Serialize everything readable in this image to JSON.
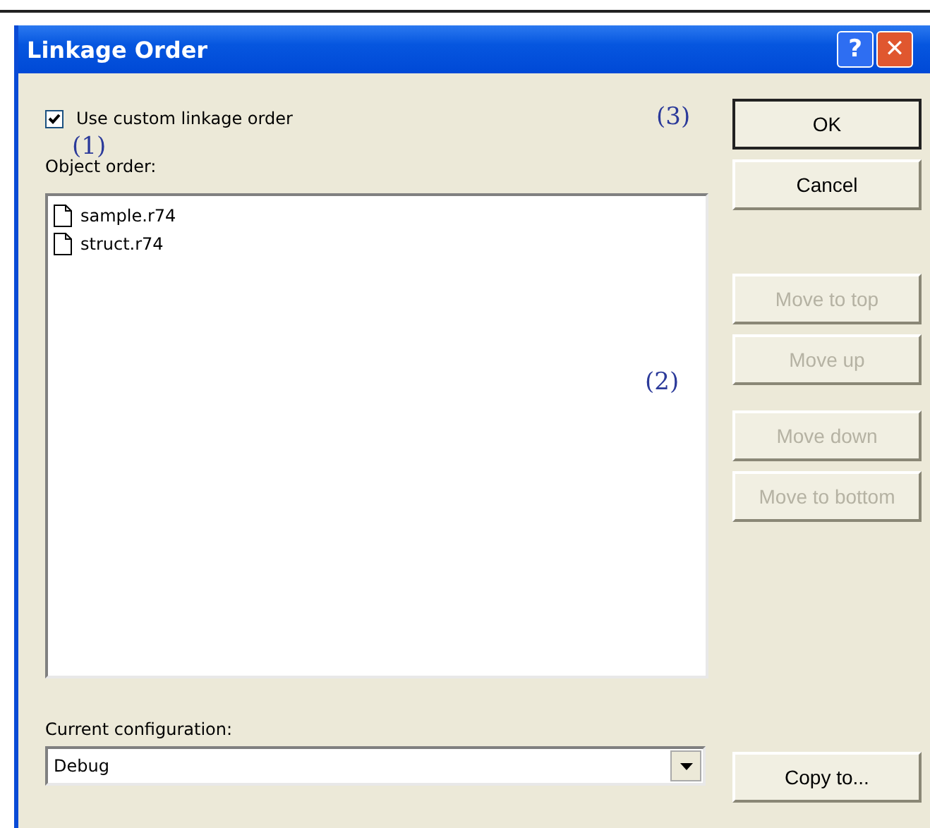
{
  "window": {
    "title": "Linkage Order",
    "title_buttons": [
      {
        "kind": "help",
        "label": "?"
      },
      {
        "kind": "close",
        "label": "✕"
      }
    ]
  },
  "custom_order": {
    "label": "Use custom linkage order",
    "checked": true
  },
  "object_order": {
    "label": "Object order:",
    "items": [
      {
        "label": "sample.r74"
      },
      {
        "label": "struct.r74"
      }
    ]
  },
  "configuration": {
    "label": "Current configuration:",
    "value": "Debug"
  },
  "button_groups": [
    {
      "buttons": [
        {
          "label": "OK",
          "default": true,
          "disabled": false
        },
        {
          "label": "Cancel",
          "default": false,
          "disabled": false
        }
      ]
    },
    {
      "buttons": [
        {
          "label": "Move to top",
          "default": false,
          "disabled": true
        },
        {
          "label": "Move up",
          "default": false,
          "disabled": true
        }
      ]
    },
    {
      "buttons": [
        {
          "label": "Move down",
          "default": false,
          "disabled": true
        },
        {
          "label": "Move to bottom",
          "default": false,
          "disabled": true
        }
      ]
    },
    {
      "buttons": [
        {
          "label": "Copy to...",
          "default": false,
          "disabled": false
        }
      ]
    }
  ],
  "callouts": [
    "(1)",
    "(2)",
    "(3)"
  ]
}
